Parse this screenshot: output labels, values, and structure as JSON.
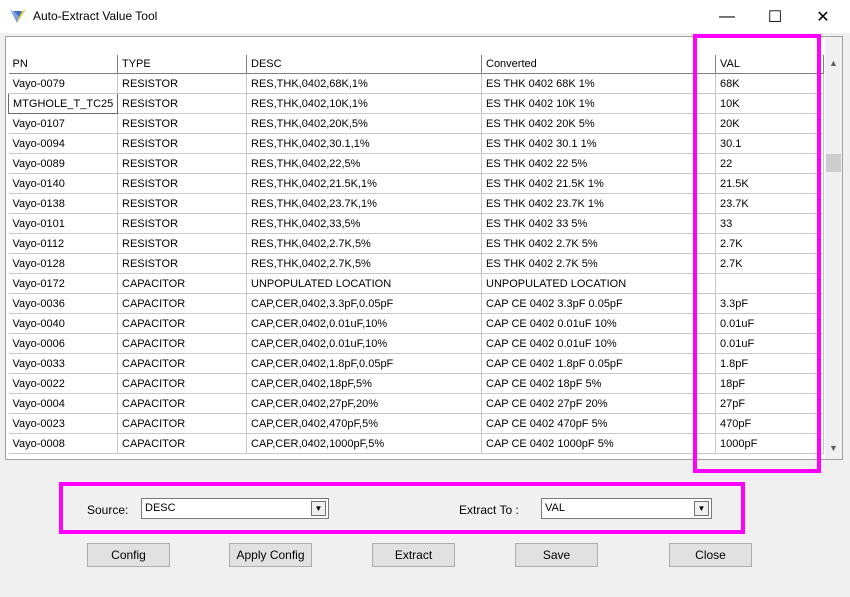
{
  "window": {
    "title": "Auto-Extract Value Tool",
    "minimize_icon": "minimize-icon",
    "maximize_icon": "maximize-icon",
    "close_icon": "close-icon"
  },
  "grid": {
    "columns": [
      "PN",
      "TYPE",
      "DESC",
      "Converted",
      "VAL"
    ],
    "rows": [
      [
        "Vayo-0079",
        "RESISTOR",
        "RES,THK,0402,68K,1%",
        "ES THK 0402 68K 1%",
        "68K"
      ],
      [
        "MTGHOLE_T_TC25",
        "RESISTOR",
        "RES,THK,0402,10K,1%",
        "ES THK 0402 10K 1%",
        "10K"
      ],
      [
        "Vayo-0107",
        "RESISTOR",
        "RES,THK,0402,20K,5%",
        "ES THK 0402 20K 5%",
        "20K"
      ],
      [
        "Vayo-0094",
        "RESISTOR",
        "RES,THK,0402,30.1,1%",
        "ES THK 0402 30.1 1%",
        "30.1"
      ],
      [
        "Vayo-0089",
        "RESISTOR",
        "RES,THK,0402,22,5%",
        "ES THK 0402 22 5%",
        "22"
      ],
      [
        "Vayo-0140",
        "RESISTOR",
        "RES,THK,0402,21.5K,1%",
        "ES THK 0402 21.5K 1%",
        "21.5K"
      ],
      [
        "Vayo-0138",
        "RESISTOR",
        "RES,THK,0402,23.7K,1%",
        "ES THK 0402 23.7K 1%",
        "23.7K"
      ],
      [
        "Vayo-0101",
        "RESISTOR",
        "RES,THK,0402,33,5%",
        "ES THK 0402 33 5%",
        "33"
      ],
      [
        "Vayo-0112",
        "RESISTOR",
        "RES,THK,0402,2.7K,5%",
        "ES THK 0402 2.7K 5%",
        "2.7K"
      ],
      [
        "Vayo-0128",
        "RESISTOR",
        "RES,THK,0402,2.7K,5%",
        "ES THK 0402 2.7K 5%",
        "2.7K"
      ],
      [
        "Vayo-0172",
        "CAPACITOR",
        "UNPOPULATED LOCATION",
        "UNPOPULATED LOCATION",
        ""
      ],
      [
        "Vayo-0036",
        "CAPACITOR",
        "CAP,CER,0402,3.3pF,0.05pF",
        "CAP CE  0402 3.3pF 0.05pF",
        "3.3pF"
      ],
      [
        "Vayo-0040",
        "CAPACITOR",
        "CAP,CER,0402,0.01uF,10%",
        "CAP CE  0402 0.01uF 10%",
        "0.01uF"
      ],
      [
        "Vayo-0006",
        "CAPACITOR",
        "CAP,CER,0402,0.01uF,10%",
        "CAP CE  0402 0.01uF 10%",
        "0.01uF"
      ],
      [
        "Vayo-0033",
        "CAPACITOR",
        "CAP,CER,0402,1.8pF,0.05pF",
        "CAP CE  0402 1.8pF 0.05pF",
        "1.8pF"
      ],
      [
        "Vayo-0022",
        "CAPACITOR",
        "CAP,CER,0402,18pF,5%",
        "CAP CE  0402 18pF 5%",
        "18pF"
      ],
      [
        "Vayo-0004",
        "CAPACITOR",
        "CAP,CER,0402,27pF,20%",
        "CAP CE  0402 27pF 20%",
        "27pF"
      ],
      [
        "Vayo-0023",
        "CAPACITOR",
        "CAP,CER,0402,470pF,5%",
        "CAP CE  0402 470pF 5%",
        "470pF"
      ],
      [
        "Vayo-0008",
        "CAPACITOR",
        "CAP,CER,0402,1000pF,5%",
        "CAP CE  0402 1000pF 5%",
        "1000pF"
      ]
    ]
  },
  "controls": {
    "source_label": "Source:",
    "source_value": "DESC",
    "extract_to_label": "Extract To :",
    "extract_to_value": "VAL"
  },
  "buttons": {
    "config": "Config",
    "apply_config": "Apply Config",
    "extract": "Extract",
    "save": "Save",
    "close": "Close"
  },
  "colors": {
    "highlight": "#ff00ff",
    "window_bg": "#f0f0f0"
  }
}
